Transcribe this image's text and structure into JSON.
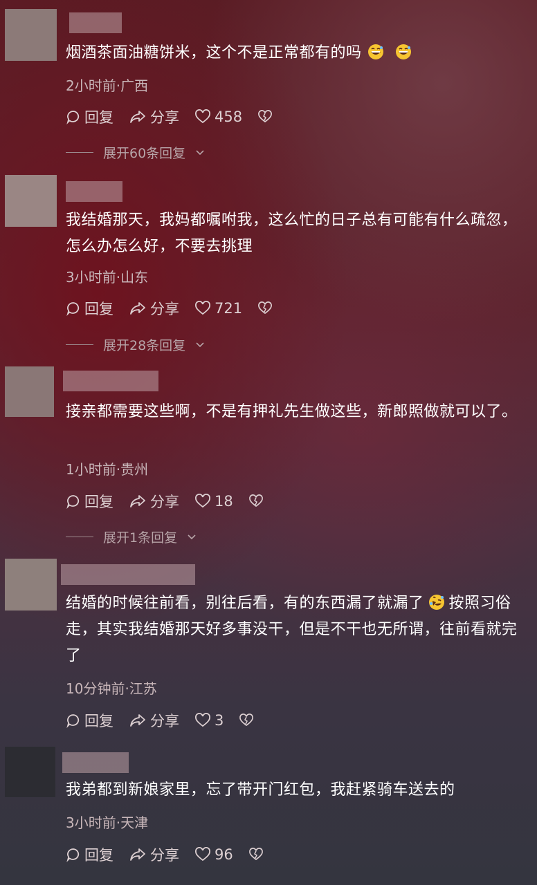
{
  "labels": {
    "reply": "回复",
    "share": "分享"
  },
  "comments": [
    {
      "text": "烟酒茶面油糖饼米，这个不是正常都有的吗",
      "meta": "2小时前·广西",
      "likes": "458",
      "expand": "展开60条回复",
      "emojis": [
        "grinning-sweat-emoji",
        "grinning-sweat-emoji"
      ]
    },
    {
      "text": "我结婚那天，我妈都嘱咐我，这么忙的日子总有可能有什么疏忽，怎么办怎么好，不要去挑理",
      "meta": "3小时前·山东",
      "likes": "721",
      "expand": "展开28条回复"
    },
    {
      "text": "接亲都需要这些啊，不是有押礼先生做这些，新郎照做就可以了。",
      "meta": "1小时前·贵州",
      "likes": "18",
      "expand": "展开1条回复"
    },
    {
      "text_a": "结婚的时候往前看，别往后看，有的东西漏了就漏了",
      "text_b": "按照习俗走，其实我结婚那天好多事没干，但是不干也无所谓，往前看就完了",
      "meta": "10分钟前·江苏",
      "likes": "3",
      "emojis": [
        "rolling-laughing-emoji"
      ]
    },
    {
      "text": "我弟都到新娘家里，忘了带开门红包，我赶紧骑车送去的",
      "meta": "3小时前·天津",
      "likes": "96"
    }
  ],
  "colors": {
    "avatar": "#8c7a78",
    "text": "#ffffff",
    "meta": "#c9b7ba"
  }
}
